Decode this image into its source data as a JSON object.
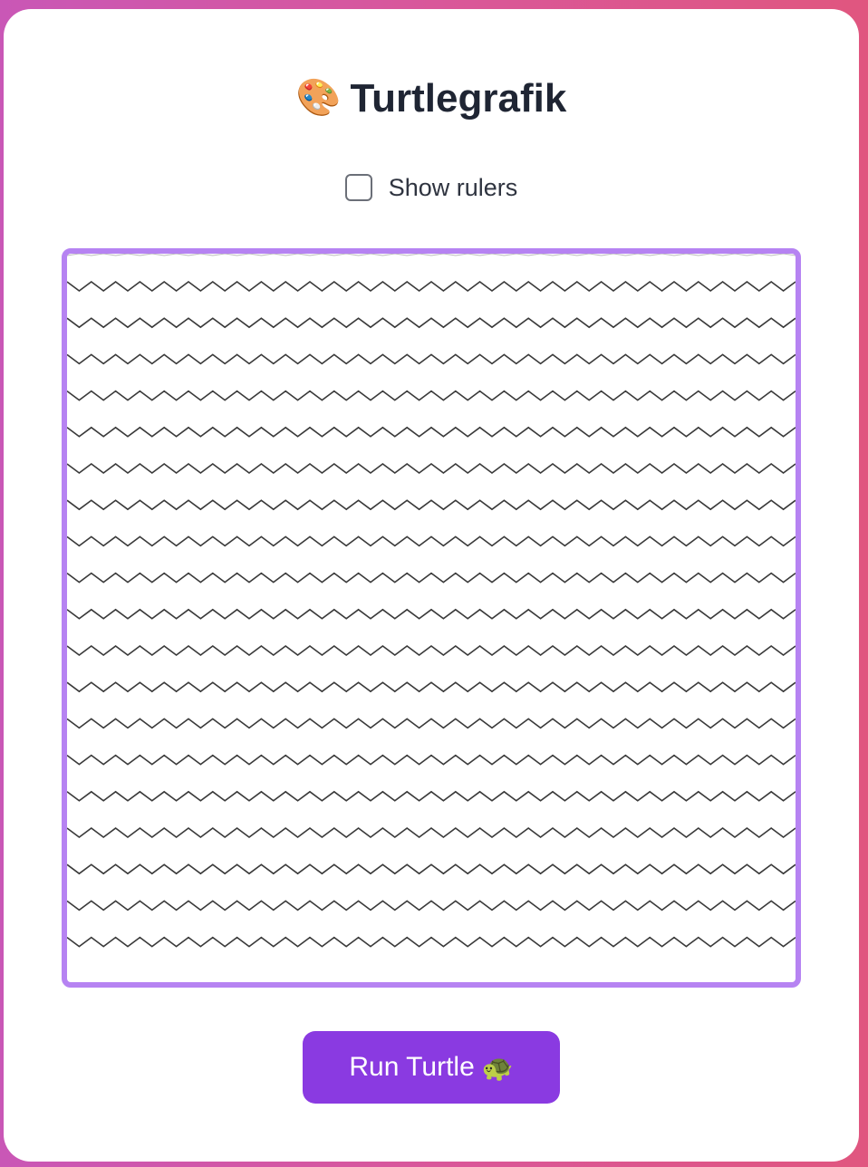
{
  "header": {
    "icon": "palette-icon",
    "icon_glyph": "🎨",
    "title": "Turtlegrafik"
  },
  "options": {
    "show_rulers_label": "Show rulers",
    "show_rulers_checked": false
  },
  "canvas": {
    "stroke_color": "#3a3a3a",
    "frame_color": "#b683f2",
    "background": "#ffffff",
    "zigzag_rows": 19,
    "teeth_per_row": 30
  },
  "actions": {
    "run_label": "Run Turtle",
    "run_icon": "turtle-icon",
    "run_icon_glyph": "🐢",
    "run_color": "#8a3ae1"
  },
  "colors": {
    "background_gradient_start": "#c957b6",
    "background_gradient_end": "#e0567f",
    "title_color": "#1f2533"
  }
}
